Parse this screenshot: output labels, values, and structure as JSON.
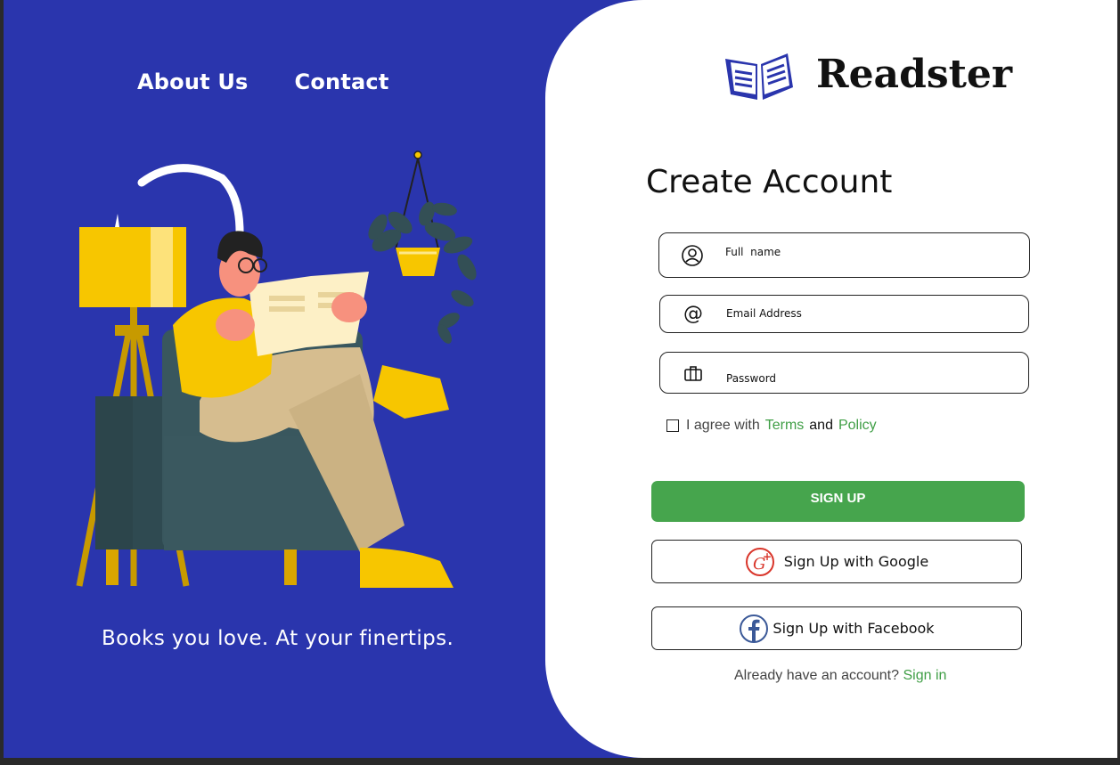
{
  "nav": {
    "about": "About Us",
    "contact": "Contact"
  },
  "tagline": "Books you love. At your finertips.",
  "brand": {
    "name": "Readster",
    "logo_icon": "open-book-icon"
  },
  "form": {
    "title": "Create Account",
    "full_name_placeholder": "Full  name",
    "email_placeholder": "Email Address",
    "password_placeholder": "Password",
    "agree_prefix": "I agree with",
    "terms": "Terms",
    "and": "and",
    "policy": "Policy",
    "signup_label": "SIGN UP",
    "google_label": "Sign Up with Google",
    "facebook_label": "Sign Up with Facebook",
    "have_account": "Already have an account?",
    "signin": "Sign in"
  },
  "icons": {
    "full_name": "user-circle-icon",
    "email": "at-sign-icon",
    "password": "briefcase-icon",
    "google": "google-plus-icon",
    "facebook": "facebook-icon"
  },
  "colors": {
    "primary_blue": "#2a35ad",
    "accent_green": "#46a54d",
    "link_green": "#3f9e45",
    "illustration_yellow": "#f7c600"
  }
}
